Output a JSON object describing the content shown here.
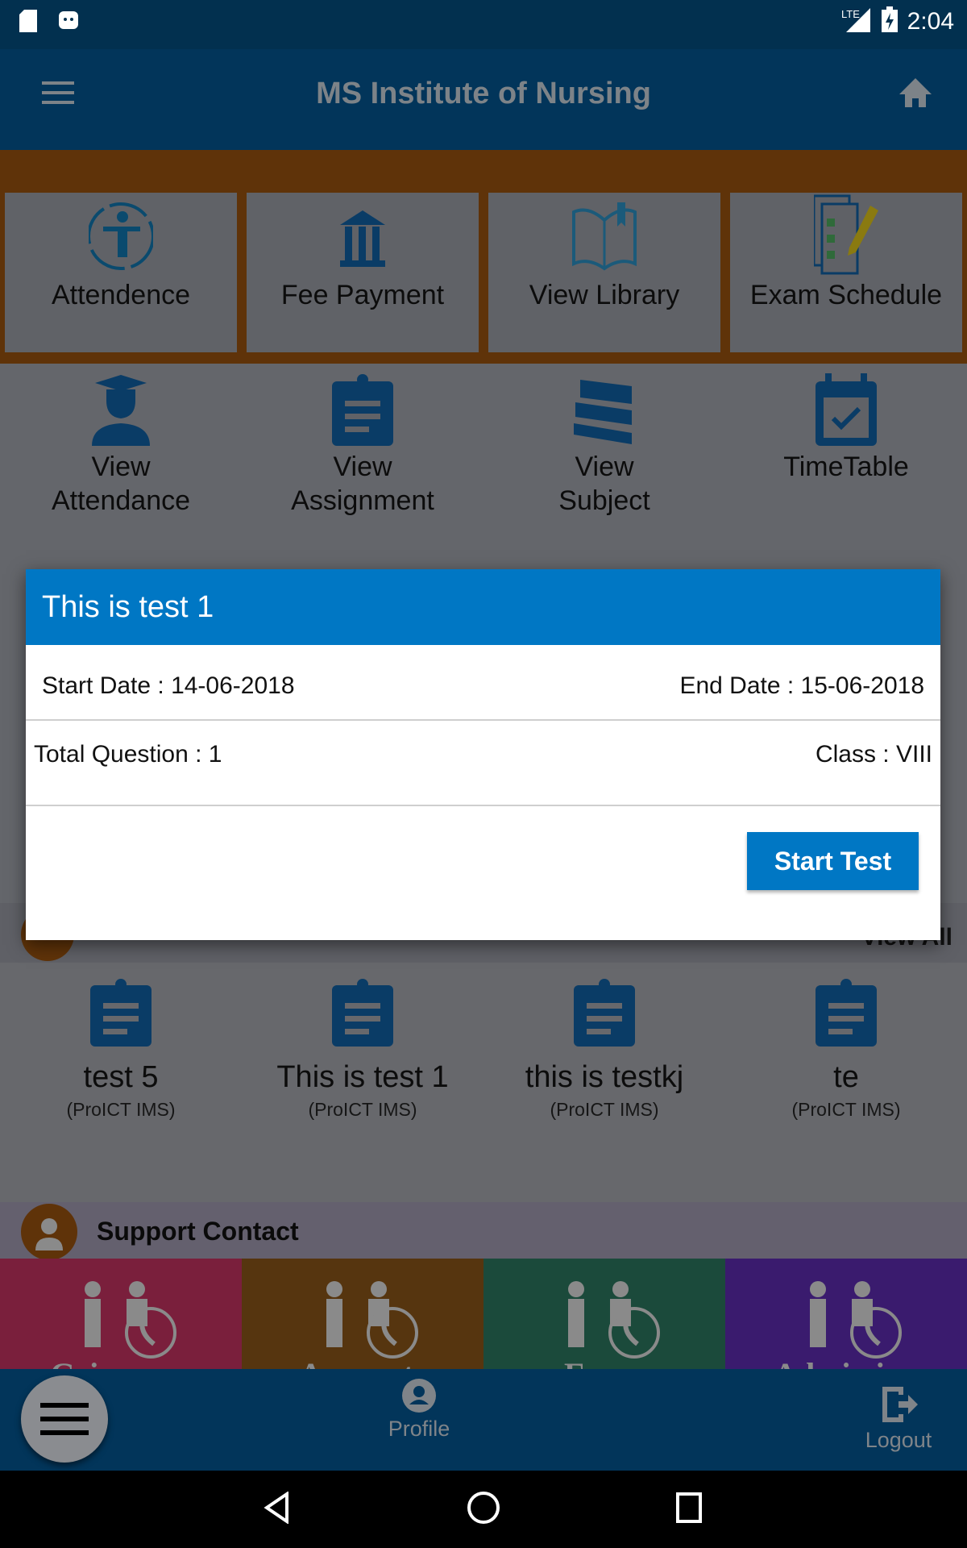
{
  "status_bar": {
    "time": "2:04",
    "network": "LTE",
    "icons": [
      "sd-card-icon",
      "android-icon",
      "signal-icon",
      "battery-charging-icon"
    ]
  },
  "app_bar": {
    "title": "MS Institute of Nursing",
    "menu_icon": "hamburger-icon",
    "home_icon": "home-icon"
  },
  "top_tiles": [
    {
      "label": "Attendence",
      "icon": "attendance-person-icon"
    },
    {
      "label": "Fee Payment",
      "icon": "bank-icon"
    },
    {
      "label": "View Library",
      "icon": "open-book-icon"
    },
    {
      "label": "Exam Schedule",
      "icon": "checklist-pencil-icon"
    }
  ],
  "grid_items": [
    {
      "line1": "View",
      "line2": "Attendance",
      "icon": "graduate-icon"
    },
    {
      "line1": "View",
      "line2": "Assignment",
      "icon": "clipboard-icon"
    },
    {
      "line1": "View",
      "line2": "Subject",
      "icon": "books-icon"
    },
    {
      "line1": "TimeTable",
      "line2": "",
      "icon": "calendar-check-icon"
    }
  ],
  "quiz_section": {
    "view_all": "View All"
  },
  "tests": [
    {
      "name": "test 5",
      "org": "(ProICT IMS)"
    },
    {
      "name": "This is test 1",
      "org": "(ProICT IMS)"
    },
    {
      "name": "this is testkj",
      "org": "(ProICT IMS)"
    },
    {
      "name": "te",
      "org": "(ProICT IMS)"
    }
  ],
  "support": {
    "title": "Support Contact",
    "tiles": [
      {
        "label": "Grievance",
        "color": "#7a1f3c"
      },
      {
        "label": "Accounts",
        "color": "#56350f"
      },
      {
        "label": "Exam",
        "color": "#1b4a3b"
      },
      {
        "label": "Admission",
        "color": "#3a1b6e"
      }
    ]
  },
  "bottom_nav": {
    "profile": "Profile",
    "logout": "Logout"
  },
  "dialog": {
    "title": "This is test 1",
    "start_date": "Start Date : 14-06-2018",
    "end_date": "End Date : 15-06-2018",
    "total_question": "Total Question : 1",
    "class": "Class : VIII",
    "button": "Start Test",
    "accent": "#0077c4"
  }
}
